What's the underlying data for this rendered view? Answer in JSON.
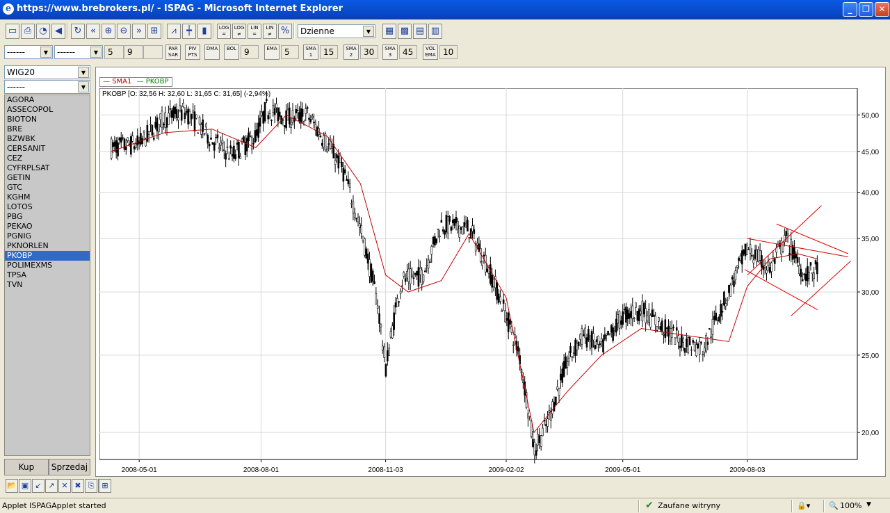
{
  "window": {
    "title": "https://www.brebrokers.pl/ - ISPAG - Microsoft Internet Explorer"
  },
  "toolbar1": {
    "buttons": [
      {
        "name": "new-window-icon",
        "glyph": "▭"
      },
      {
        "name": "print-icon",
        "glyph": "⎙"
      },
      {
        "name": "timer-icon",
        "glyph": "◔"
      },
      {
        "name": "sound-icon",
        "glyph": "◀"
      },
      {
        "name": "refresh-icon",
        "glyph": "↻"
      },
      {
        "name": "rewind-icon",
        "glyph": "«"
      },
      {
        "name": "zoom-in-icon",
        "glyph": "⊕"
      },
      {
        "name": "zoom-out-icon",
        "glyph": "⊖"
      },
      {
        "name": "forward-icon",
        "glyph": "»"
      },
      {
        "name": "fit-icon",
        "glyph": "⊞"
      },
      {
        "name": "line-chart-icon",
        "glyph": "⩘"
      },
      {
        "name": "ohlc-chart-icon",
        "glyph": "┿"
      },
      {
        "name": "candle-chart-icon",
        "glyph": "▮"
      },
      {
        "name": "scale-log-button",
        "glyph": "LOG ="
      },
      {
        "name": "scale-log-not-button",
        "glyph": "LOG ≠"
      },
      {
        "name": "scale-lin-button",
        "glyph": "LIN ="
      },
      {
        "name": "scale-lin-not-button",
        "glyph": "LIN ≠"
      },
      {
        "name": "percent-button",
        "glyph": "%"
      }
    ],
    "interval": "Dzienne",
    "right_buttons": [
      {
        "name": "chart-window-icon",
        "glyph": "▦"
      },
      {
        "name": "color-icon",
        "glyph": "▩"
      },
      {
        "name": "indicator-icon",
        "glyph": "▤"
      },
      {
        "name": "table-icon",
        "glyph": "▥"
      }
    ]
  },
  "toolbar2": {
    "combo1": "------",
    "combo2": "------",
    "par_left": "5",
    "par_right": "9",
    "par_sar": "PAR SAR",
    "piv_pts": "PIV PTS",
    "dma": "DMA",
    "bol": "BOL",
    "bol_val": "9",
    "ema": "EMA",
    "ema_val": "5",
    "sma1": "SMA 1",
    "sma1_val": "15",
    "sma2": "SMA 2",
    "sma2_val": "30",
    "sma3": "SMA 3",
    "sma3_val": "45",
    "vol_ema": "VOL EMA",
    "vol_val": "10"
  },
  "left": {
    "index": "WIG20",
    "filter": "------",
    "stocks": [
      "AGORA",
      "ASSECOPOL",
      "BIOTON",
      "BRE",
      "BZWBK",
      "CERSANIT",
      "CEZ",
      "CYFRPLSAT",
      "GETIN",
      "GTC",
      "KGHM",
      "LOTOS",
      "PBG",
      "PEKAO",
      "PGNIG",
      "PKNORLEN",
      "PKOBP",
      "POLIMEXMS",
      "TPSA",
      "TVN"
    ],
    "selected": "PKOBP",
    "buy": "Kup",
    "sell": "Sprzedaj"
  },
  "legend": {
    "sma": "SMA1",
    "ticker": "PKOBP"
  },
  "quote": "PKOBP [O: 32,56  H: 32,60  L: 31,65  C: 31,65] (-2,94%)",
  "colors": {
    "sma": "#c00000",
    "ticker": "#008000",
    "candle": "#000000",
    "selection": "#316ac5",
    "trendline": "#e00000"
  },
  "chart_data": {
    "type": "candlestick",
    "scale": "log",
    "ylim": [
      18.5,
      54
    ],
    "y_ticks": [
      "50,00",
      "45,00",
      "40,00",
      "35,00",
      "30,00",
      "25,00",
      "20,00"
    ],
    "y_tick_values": [
      50,
      45,
      40,
      35,
      30,
      25,
      20
    ],
    "x_ticks": [
      "2008-05-01",
      "2008-08-01",
      "2008-11-03",
      "2009-02-02",
      "2009-05-01",
      "2009-08-03"
    ],
    "series": [
      {
        "name": "PKOBP",
        "x": [
          "2008-04-10",
          "2008-05-01",
          "2008-05-20",
          "2008-06-05",
          "2008-06-25",
          "2008-07-10",
          "2008-07-28",
          "2008-08-05",
          "2008-08-20",
          "2008-09-05",
          "2008-09-20",
          "2008-10-01",
          "2008-10-15",
          "2008-10-28",
          "2008-11-03",
          "2008-11-15",
          "2008-12-01",
          "2008-12-15",
          "2009-01-05",
          "2009-01-20",
          "2009-02-02",
          "2009-02-12",
          "2009-02-23",
          "2009-03-05",
          "2009-03-20",
          "2009-04-01",
          "2009-04-15",
          "2009-05-01",
          "2009-05-15",
          "2009-06-01",
          "2009-06-15",
          "2009-07-01",
          "2009-07-20",
          "2009-08-03",
          "2009-08-20",
          "2009-09-01",
          "2009-09-15",
          "2009-09-25"
        ],
        "values": [
          45.5,
          46.0,
          49.5,
          50.5,
          46.5,
          44.5,
          47.0,
          51.0,
          49.5,
          50.0,
          46.0,
          43.0,
          36.0,
          29.0,
          24.0,
          31.0,
          31.5,
          36.5,
          36.0,
          32.0,
          28.0,
          25.0,
          19.0,
          20.5,
          24.5,
          26.5,
          25.5,
          28.0,
          28.5,
          27.0,
          26.0,
          25.5,
          30.0,
          34.0,
          32.0,
          35.0,
          31.5,
          32.0
        ]
      },
      {
        "name": "SMA1",
        "x": [
          "2008-04-10",
          "2008-05-20",
          "2008-06-25",
          "2008-07-28",
          "2008-08-20",
          "2008-09-20",
          "2008-10-15",
          "2008-11-03",
          "2008-11-20",
          "2008-12-15",
          "2009-01-05",
          "2009-02-02",
          "2009-02-23",
          "2009-03-20",
          "2009-04-15",
          "2009-05-15",
          "2009-06-15",
          "2009-07-20",
          "2009-08-03",
          "2009-08-20",
          "2009-09-10",
          "2009-09-25"
        ],
        "values": [
          45.0,
          47.5,
          48.0,
          45.5,
          50.0,
          47.0,
          41.0,
          31.5,
          30.0,
          31.0,
          35.5,
          29.5,
          20.0,
          22.5,
          25.0,
          27.0,
          26.5,
          26.0,
          30.5,
          33.0,
          33.5,
          33.0
        ]
      }
    ],
    "annotations": [
      "triangle trendlines"
    ]
  },
  "bottom_buttons": [
    {
      "name": "open-folder-icon",
      "glyph": "📂"
    },
    {
      "name": "save-icon",
      "glyph": "▣"
    },
    {
      "name": "export-icon",
      "glyph": "↙"
    },
    {
      "name": "import-icon",
      "glyph": "↗"
    },
    {
      "name": "delete-icon",
      "glyph": "✕"
    },
    {
      "name": "delete-all-icon",
      "glyph": "✖"
    },
    {
      "name": "copy-icon",
      "glyph": "⎘"
    },
    {
      "name": "paste-icon",
      "glyph": "▤"
    }
  ],
  "status": {
    "text": "Applet ISPAGApplet started",
    "zone": "Zaufane witryny",
    "zoom": "100%"
  }
}
